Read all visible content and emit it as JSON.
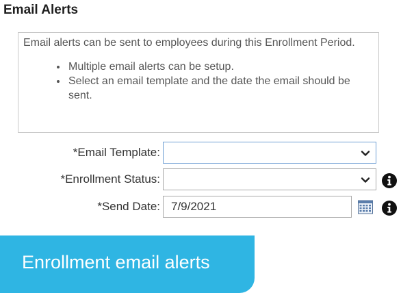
{
  "section": {
    "title": "Email Alerts"
  },
  "info_box": {
    "intro": "Email alerts can be sent to employees during this Enrollment Period.",
    "bullets": [
      "Multiple email alerts can be setup.",
      "Select an email template and the date the email should be sent."
    ]
  },
  "form": {
    "required_marker": "*",
    "email_template": {
      "label": "Email Template:",
      "value": ""
    },
    "enrollment_status": {
      "label": "Enrollment Status:",
      "value": ""
    },
    "send_date": {
      "label": "Send Date:",
      "value": "7/9/2021"
    }
  },
  "icons": {
    "dropdown": "chevron-down-icon",
    "calendar": "calendar-icon",
    "info": "info-icon"
  },
  "banner": {
    "text": "Enrollment email alerts",
    "color": "#2fb5e3"
  }
}
